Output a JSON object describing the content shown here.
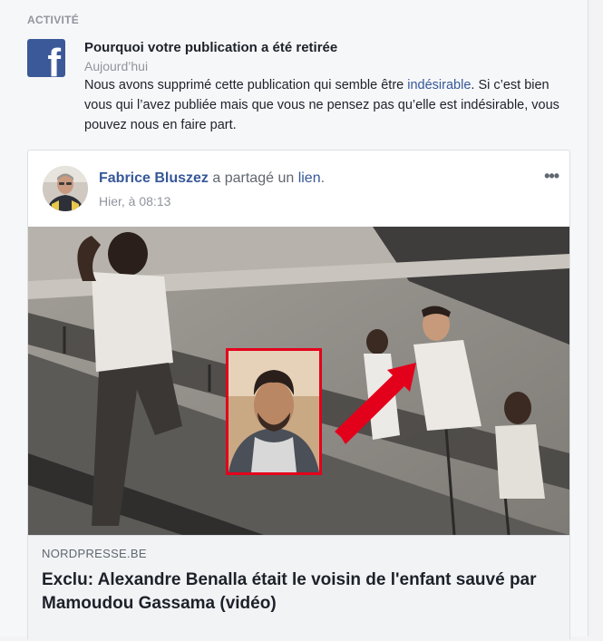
{
  "activity": {
    "section_title": "ACTIVITÉ",
    "logo_letter": "f",
    "notification": {
      "title": "Pourquoi votre publication a été retirée",
      "time": "Aujourd’hui",
      "body_before": "Nous avons supprimé cette publication qui semble être ",
      "body_link": "indésirable",
      "body_after": ". Si c’est bien vous qui l’avez publiée mais que vous ne pensez pas qu’elle est indésirable, vous pouvez nous en faire part."
    }
  },
  "post": {
    "author": "Fabrice Bluszez",
    "action_text": " a partagé un ",
    "link_word": "lien",
    "end_punct": ".",
    "time": "Hier, à 08:13",
    "more_label": "•••",
    "link_preview": {
      "domain": "NORDPRESSE.BE",
      "headline": "Exclu: Alexandre Benalla était le voisin de l'enfant sauvé par Mamoudou Gassama (vidéo)"
    }
  },
  "colors": {
    "facebook_blue": "#3b5998",
    "link_blue": "#365899",
    "arrow_red": "#e3001b"
  }
}
